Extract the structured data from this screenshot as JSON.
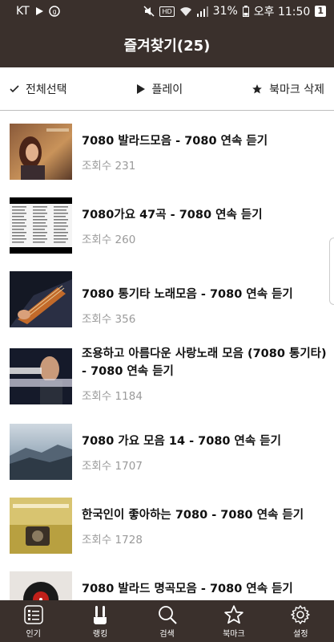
{
  "status_bar": {
    "carrier": "KT",
    "battery_percent": "31%",
    "time": "오후 11:50",
    "notification_count": "1"
  },
  "header": {
    "title": "즐겨찾기(25)"
  },
  "toolbar": {
    "select_all_label": "전체선택",
    "play_label": "플레이",
    "delete_bookmark_label": "북마크 삭제"
  },
  "list": {
    "items": [
      {
        "title": "7080 발라드모음 - 7080 연속 듣기",
        "views": "조회수 231"
      },
      {
        "title": "7080가요 47곡 - 7080 연속 듣기",
        "views": "조회수 260"
      },
      {
        "title": "7080 통기타 노래모음 - 7080 연속 듣기",
        "views": "조회수 356"
      },
      {
        "title": "조용하고 아름다운 사랑노래 모음 (7080 통기타) - 7080 연속 듣기",
        "views": "조회수 1184"
      },
      {
        "title": "7080 가요 모음 14 - 7080 연속 듣기",
        "views": "조회수 1707"
      },
      {
        "title": "한국인이 좋아하는 7080 - 7080 연속 듣기",
        "views": "조회수 1728"
      },
      {
        "title": "7080 발라드 명곡모음 - 7080 연속 듣기",
        "views": ""
      }
    ]
  },
  "bottom_nav": {
    "items": [
      {
        "label": "인기",
        "icon": "list-icon"
      },
      {
        "label": "랭킹",
        "icon": "ranking-icon"
      },
      {
        "label": "검색",
        "icon": "search-icon"
      },
      {
        "label": "북마크",
        "icon": "star-icon"
      },
      {
        "label": "설정",
        "icon": "gear-icon"
      }
    ]
  },
  "colors": {
    "bar_bg": "#3a302c",
    "views_text": "#9a9a9a"
  }
}
